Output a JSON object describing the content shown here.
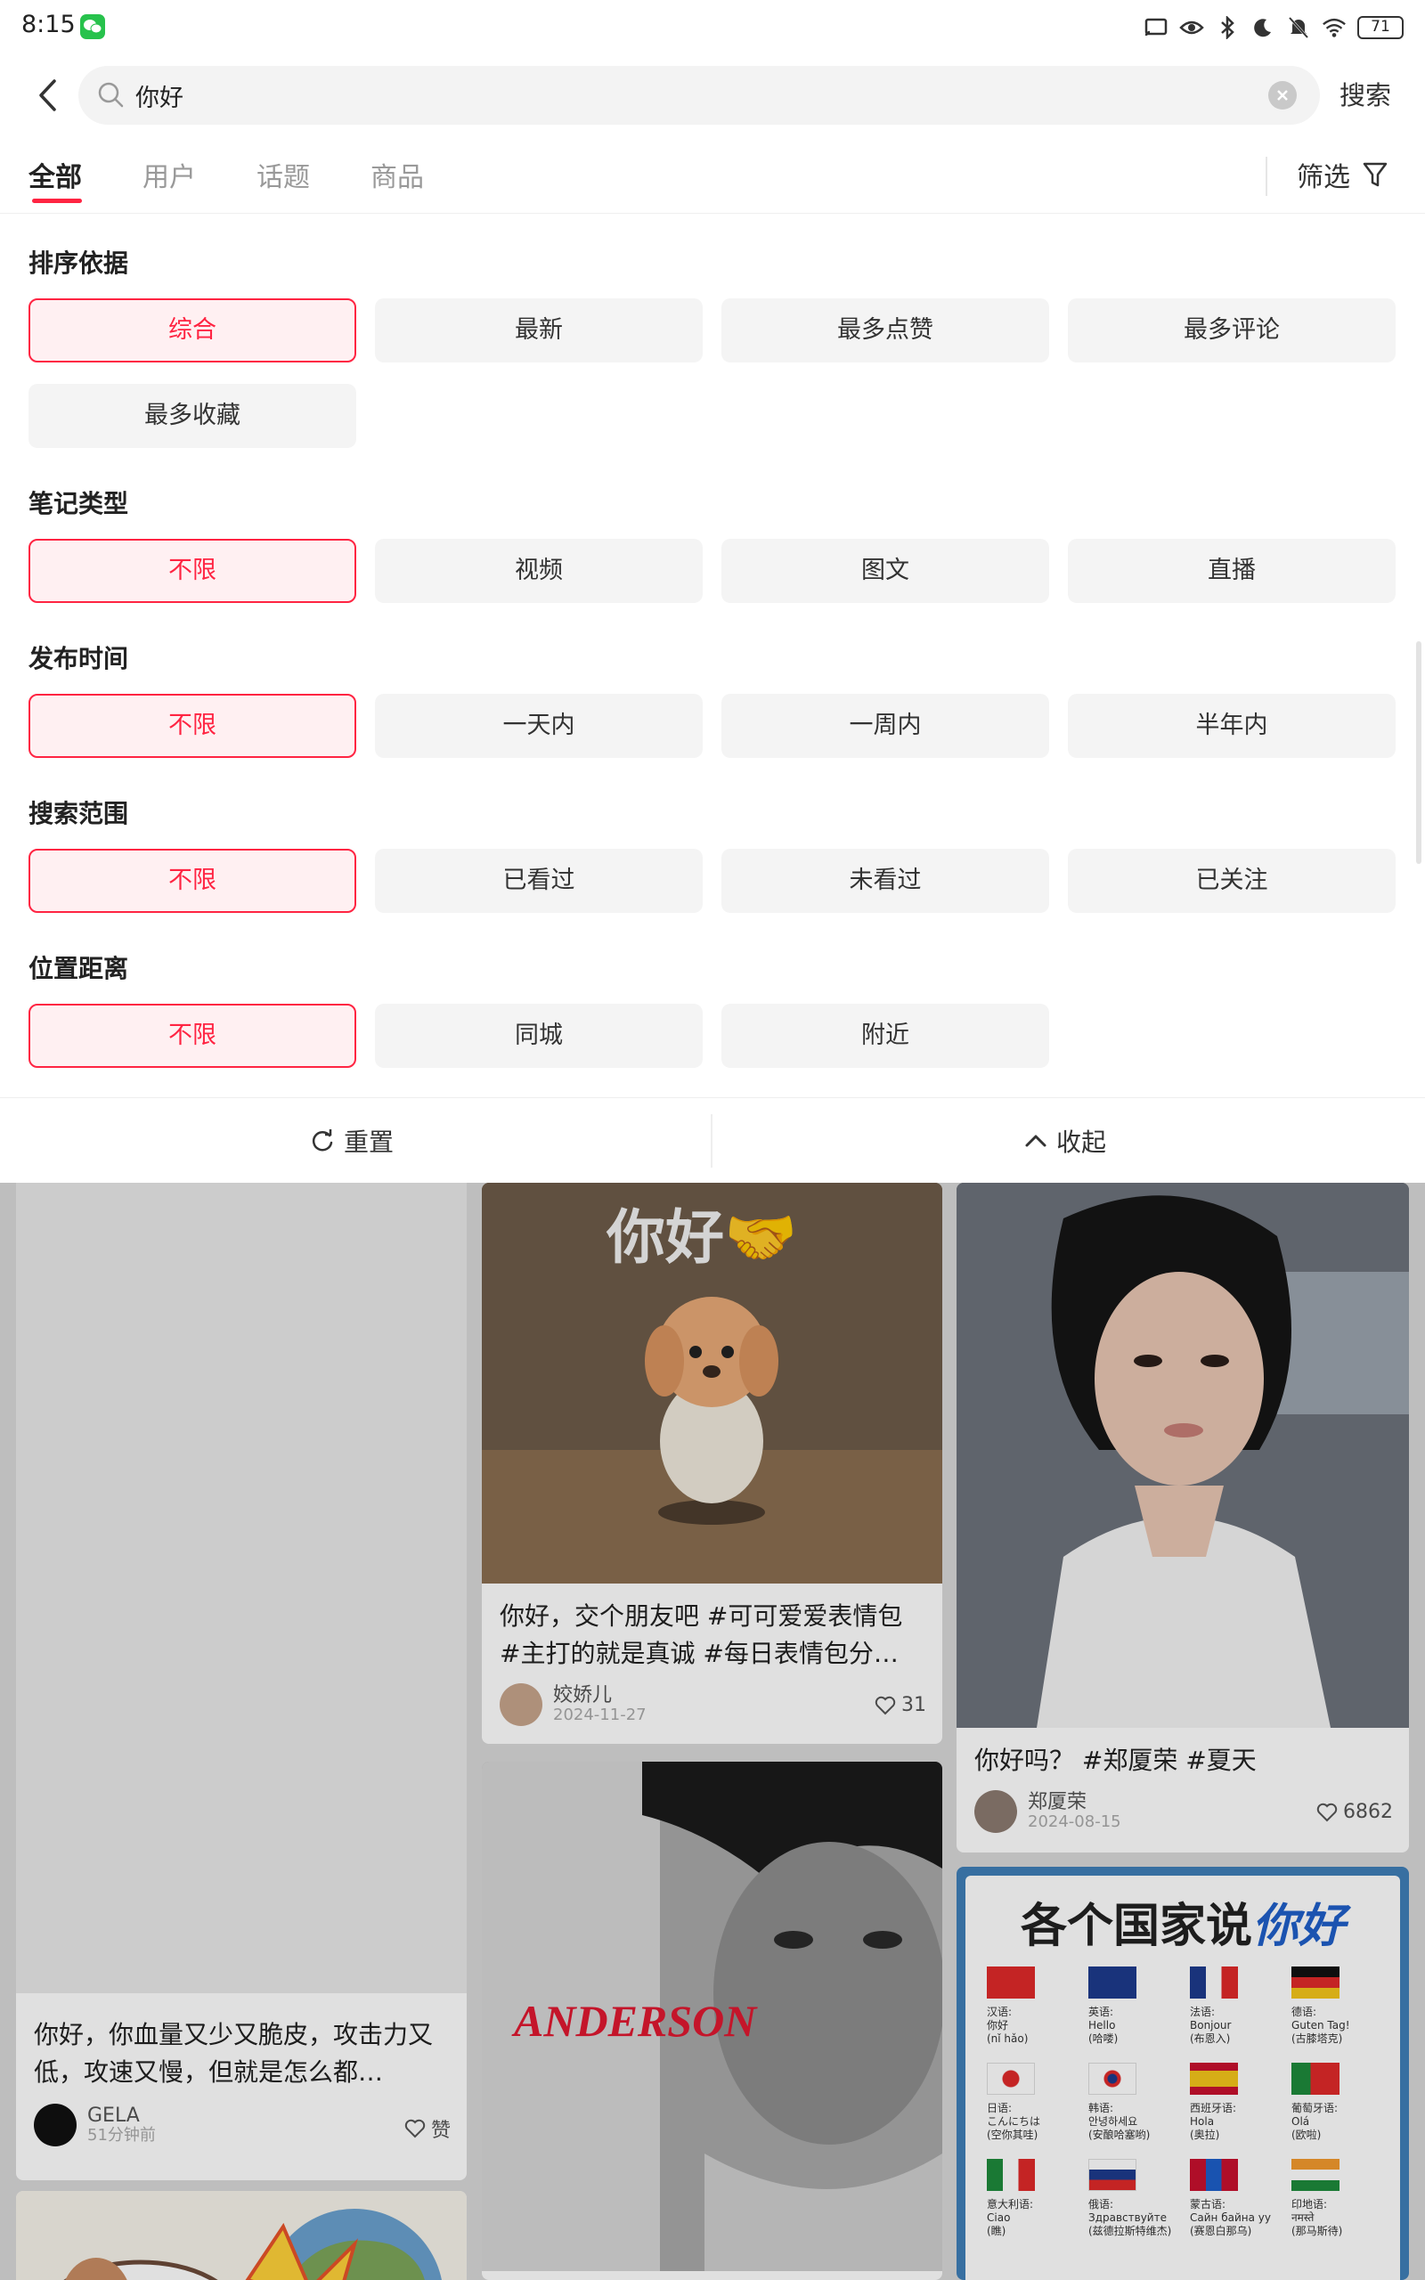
{
  "status_bar": {
    "time": "8:15",
    "battery": "71"
  },
  "search": {
    "query": "你好",
    "button": "搜索"
  },
  "tabs": [
    {
      "label": "全部",
      "active": true
    },
    {
      "label": "用户",
      "active": false
    },
    {
      "label": "话题",
      "active": false
    },
    {
      "label": "商品",
      "active": false
    }
  ],
  "filter_label": "筛选",
  "filters": [
    {
      "title": "排序依据",
      "options": [
        "综合",
        "最新",
        "最多点赞",
        "最多评论",
        "最多收藏"
      ],
      "selected": "综合"
    },
    {
      "title": "笔记类型",
      "options": [
        "不限",
        "视频",
        "图文",
        "直播"
      ],
      "selected": "不限"
    },
    {
      "title": "发布时间",
      "options": [
        "不限",
        "一天内",
        "一周内",
        "半年内"
      ],
      "selected": "不限"
    },
    {
      "title": "搜索范围",
      "options": [
        "不限",
        "已看过",
        "未看过",
        "已关注"
      ],
      "selected": "不限"
    },
    {
      "title": "位置距离",
      "options": [
        "不限",
        "同城",
        "附近"
      ],
      "selected": "不限"
    }
  ],
  "actions": {
    "reset": "重置",
    "collapse": "收起"
  },
  "feed": [
    {
      "title": "你好，你血量又少又脆皮，攻击力又低，攻速又慢，但就是怎么都…",
      "author": "GELA",
      "date": "51分钟前",
      "likes": "赞"
    },
    {
      "image_text": "你好🤝",
      "title": "你好，交个朋友吧 #可可爱爱表情包 #主打的就是真诚 #每日表情包分…",
      "author": "姣娇儿",
      "date": "2024-11-27",
      "likes": "31"
    },
    {
      "title": "你好吗？ #郑厦荣 #夏天",
      "author": "郑厦荣",
      "date": "2024-08-15",
      "likes": "6862"
    },
    {
      "image_text": "ANDERSON"
    },
    {
      "image_title": "各个国家说你好",
      "image_title_prefix": "各个国家说",
      "image_title_highlight": "你好",
      "languages": [
        {
          "lang": "汉语:",
          "word": "你好",
          "reading": "(nǐ hǎo)"
        },
        {
          "lang": "英语:",
          "word": "Hello",
          "reading": "(哈喽)"
        },
        {
          "lang": "法语:",
          "word": "Bonjour",
          "reading": "(布恩入)"
        },
        {
          "lang": "德语:",
          "word": "Guten Tag!",
          "reading": "(古膝塔克)"
        },
        {
          "lang": "日语:",
          "word": "こんにちは",
          "reading": "(空你其哇)"
        },
        {
          "lang": "韩语:",
          "word": "안녕하세요",
          "reading": "(安酿哈塞哟)"
        },
        {
          "lang": "西班牙语:",
          "word": "Hola",
          "reading": "(奥拉)"
        },
        {
          "lang": "葡萄牙语:",
          "word": "Olá",
          "reading": "(欧啦)"
        },
        {
          "lang": "意大利语:",
          "word": "Ciao",
          "reading": "(瞧)"
        },
        {
          "lang": "俄语:",
          "word": "Здравствуйте",
          "reading": "(兹德拉斯特维杰)"
        },
        {
          "lang": "蒙古语:",
          "word": "Сайн байна уу",
          "reading": "(赛恩白那乌)"
        },
        {
          "lang": "印地语:",
          "word": "नमस्ते",
          "reading": "(那马斯待)"
        }
      ]
    }
  ],
  "colors": {
    "accent": "#ff2442",
    "selected_bg": "#fff0f2",
    "chip_bg": "#f4f4f4"
  }
}
